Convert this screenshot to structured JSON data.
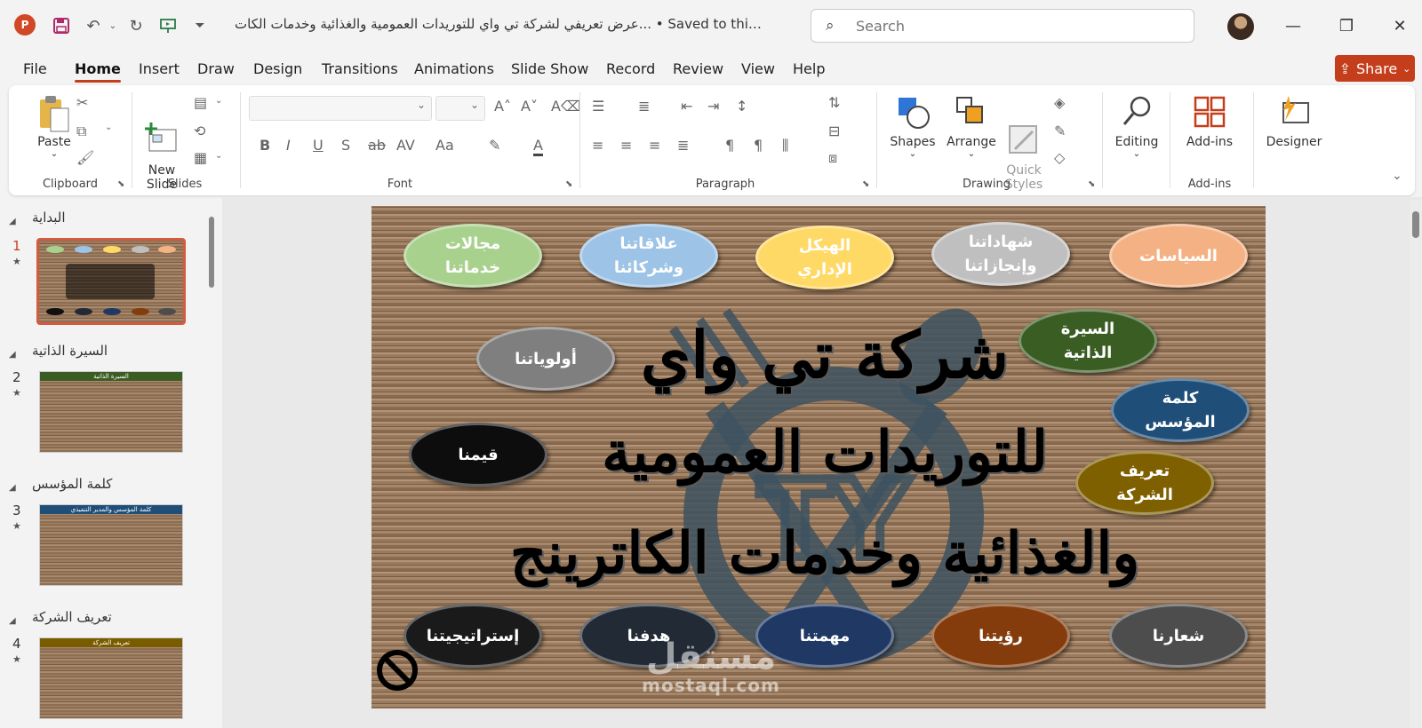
{
  "titlebar": {
    "doc_title": "عرض تعريفي لشركة تي واي للتوريدات العمومية والغذائية وخدمات الكات... • Saved to this PC",
    "search_placeholder": "Search",
    "app_icon_letter": "P"
  },
  "menu": {
    "tabs": [
      "File",
      "Home",
      "Insert",
      "Draw",
      "Design",
      "Transitions",
      "Animations",
      "Slide Show",
      "Record",
      "Review",
      "View",
      "Help"
    ],
    "active": "Home",
    "share_label": "Share"
  },
  "ribbon": {
    "clipboard": {
      "paste": "Paste",
      "label": "Clipboard"
    },
    "slides": {
      "new_slide": "New\nSlide",
      "label": "Slides"
    },
    "font": {
      "label": "Font"
    },
    "paragraph": {
      "label": "Paragraph"
    },
    "drawing": {
      "shapes": "Shapes",
      "arrange": "Arrange",
      "quick_styles": "Quick\nStyles",
      "label": "Drawing"
    },
    "editing": {
      "label": "Editing"
    },
    "addins": {
      "button": "Add-ins",
      "label": "Add-ins"
    },
    "designer": {
      "button": "Designer"
    }
  },
  "thumbnails": {
    "sections": [
      {
        "name": "البداية",
        "slide": "1"
      },
      {
        "name": "السيرة الذاتية",
        "slide": "2"
      },
      {
        "name": "كلمة المؤسس",
        "slide": "3"
      },
      {
        "name": "تعريف الشركة",
        "slide": "4"
      }
    ],
    "thumb_headers": [
      "السيرة الذاتية",
      "كلمة المؤسس والمدير التنفيذي",
      "تعريف الشركة"
    ],
    "thumb_colors": [
      "#3a5d23",
      "#1f4e79",
      "#7a5c00"
    ]
  },
  "slide": {
    "title_line1": "شركة تي واي",
    "title_line2": "للتوريدات العمومية",
    "title_line3": "والغذائية وخدمات الكاترينج",
    "bubbles": [
      {
        "text": "مجالات\nخدماتنا",
        "color": "#a9d18e"
      },
      {
        "text": "علاقاتنا\nوشركائنا",
        "color": "#9dc3e6"
      },
      {
        "text": "الهيكل\nالإداري",
        "color": "#ffd966"
      },
      {
        "text": "شهاداتنا\nوإنجازاتنا",
        "color": "#bfbfbf"
      },
      {
        "text": "السياسات",
        "color": "#f4b183"
      },
      {
        "text": "أولوياتنا",
        "color": "#7f7f7f"
      },
      {
        "text": "السيرة\nالذاتية",
        "color": "#3a5d23"
      },
      {
        "text": "كلمة\nالمؤسس",
        "color": "#1f4e79"
      },
      {
        "text": "قيمنا",
        "color": "#0d0d0d"
      },
      {
        "text": "تعريف\nالشركة",
        "color": "#7f6000"
      },
      {
        "text": "إستراتيجيتنا",
        "color": "#1a1a1a"
      },
      {
        "text": "هدفنا",
        "color": "#222a35"
      },
      {
        "text": "مهمتنا",
        "color": "#203864"
      },
      {
        "text": "رؤيتنا",
        "color": "#843c0c"
      },
      {
        "text": "شعارنا",
        "color": "#4d4d4d"
      }
    ],
    "watermark_ar": "مستقل",
    "watermark_en": "mostaql.com"
  }
}
